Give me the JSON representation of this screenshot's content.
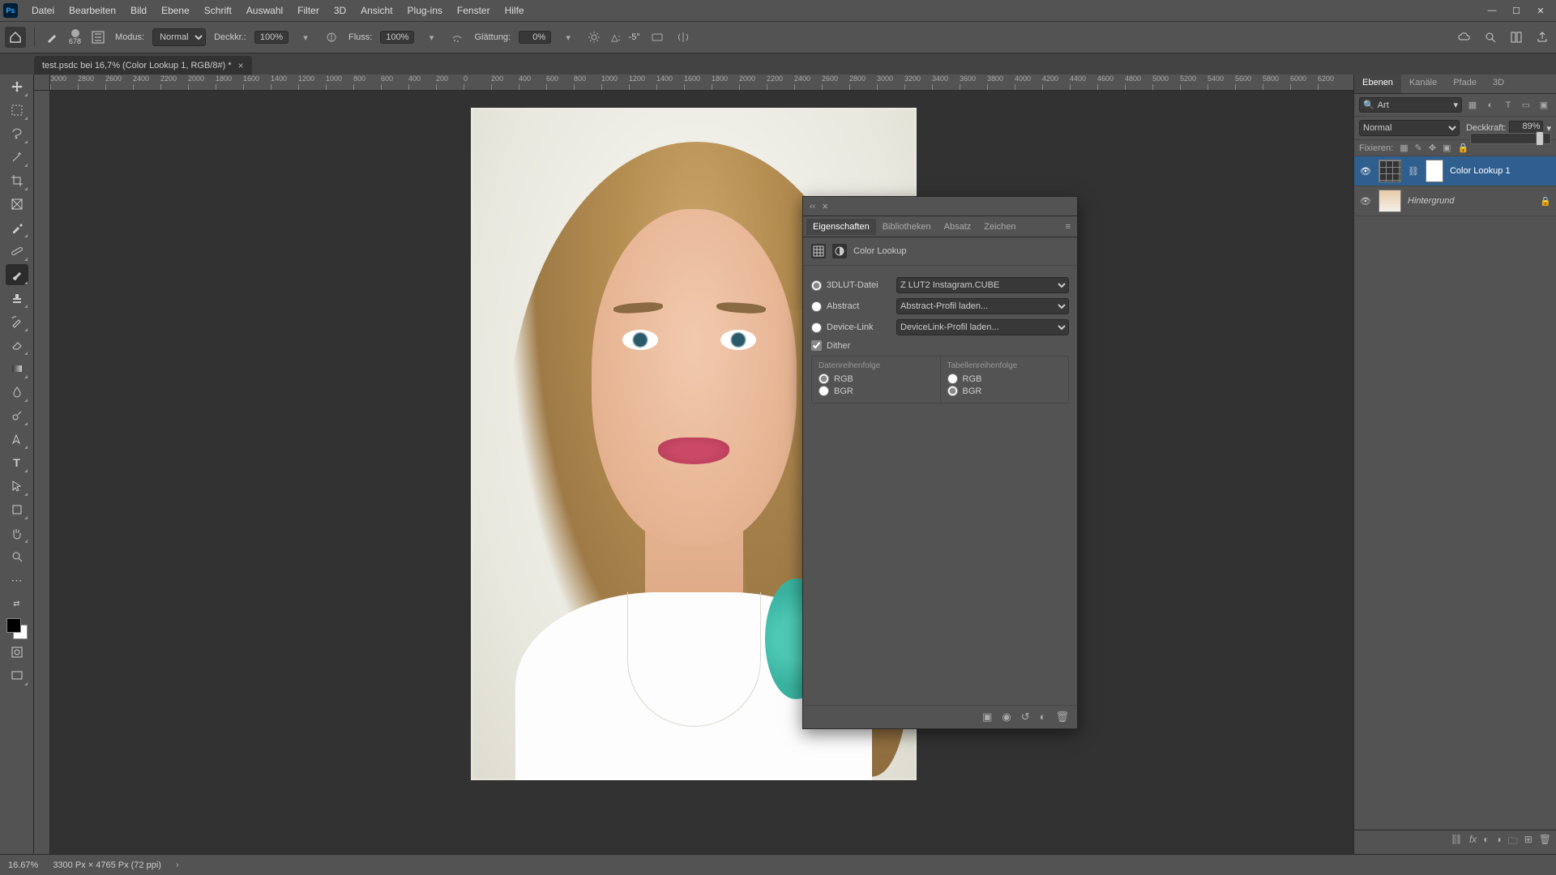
{
  "app_logo": "Ps",
  "menu": [
    "Datei",
    "Bearbeiten",
    "Bild",
    "Ebene",
    "Schrift",
    "Auswahl",
    "Filter",
    "3D",
    "Ansicht",
    "Plug-ins",
    "Fenster",
    "Hilfe"
  ],
  "options": {
    "brush_size": "678",
    "mode_label": "Modus:",
    "mode_value": "Normal",
    "opacity_label": "Deckkr.:",
    "opacity_value": "100%",
    "flow_label": "Fluss:",
    "flow_value": "100%",
    "smoothing_label": "Glättung:",
    "smoothing_value": "0%",
    "angle_label": "△:",
    "angle_value": "-5°"
  },
  "document": {
    "tab_title": "test.psdc bei 16,7% (Color Lookup 1, RGB/8#) *"
  },
  "ruler_ticks": [
    "3000",
    "2800",
    "2600",
    "2400",
    "2200",
    "2000",
    "1800",
    "1600",
    "1400",
    "1200",
    "1000",
    "800",
    "600",
    "400",
    "200",
    "0",
    "200",
    "400",
    "600",
    "800",
    "1000",
    "1200",
    "1400",
    "1600",
    "1800",
    "2000",
    "2200",
    "2400",
    "2600",
    "2800",
    "3000",
    "3200",
    "3400",
    "3600",
    "3800",
    "4000",
    "4200",
    "4400",
    "4600",
    "4800",
    "5000",
    "5200",
    "5400",
    "5600",
    "5800",
    "6000",
    "6200"
  ],
  "properties": {
    "collapse_label": "‹‹",
    "tabs": [
      "Eigenschaften",
      "Bibliotheken",
      "Absatz",
      "Zeichen"
    ],
    "active_tab": 0,
    "title": "Color Lookup",
    "rows": {
      "lut_label": "3DLUT-Datei",
      "lut_value": "Z LUT2 Instagram.CUBE",
      "abstract_label": "Abstract",
      "abstract_value": "Abstract-Profil laden...",
      "device_label": "Device-Link",
      "device_value": "DeviceLink-Profil laden...",
      "dither_label": "Dither"
    },
    "col_left_title": "Datenreihenfolge",
    "col_right_title": "Tabellenreihenfolge",
    "order_options": {
      "rgb": "RGB",
      "bgr": "BGR"
    }
  },
  "layers_panel": {
    "tabs": [
      "Ebenen",
      "Kanäle",
      "Pfade",
      "3D"
    ],
    "active_tab": 0,
    "filter_kind": "Art",
    "blend_mode": "Normal",
    "opacity_label": "Deckkraft:",
    "opacity_value": "89%",
    "opacity_slider_pct": 89,
    "lock_label": "Fixieren:",
    "layers": [
      {
        "name": "Color Lookup 1",
        "visible": true,
        "type": "adjustment",
        "selected": true
      },
      {
        "name": "Hintergrund",
        "visible": true,
        "type": "background",
        "locked": true
      }
    ]
  },
  "status": {
    "zoom": "16.67%",
    "docinfo": "3300 Px × 4765 Px (72 ppi)",
    "arrow": "›"
  }
}
